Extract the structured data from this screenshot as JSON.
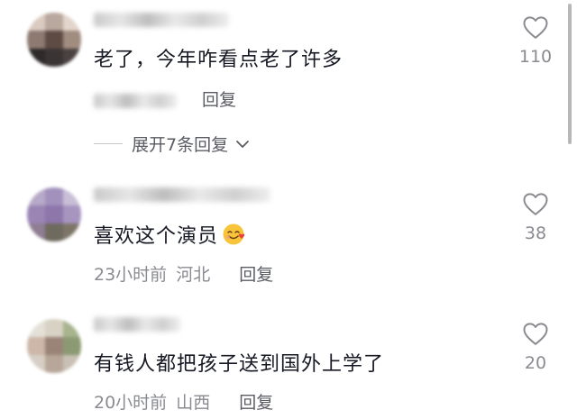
{
  "comments": [
    {
      "text": "老了，今年咋看点老了许多",
      "reply_label": "回复",
      "likes": "110",
      "expand_label": "展开7条回复"
    },
    {
      "text": "喜欢这个演员",
      "time": "23小时前",
      "location": "河北",
      "reply_label": "回复",
      "likes": "38"
    },
    {
      "text": "有钱人都把孩子送到国外上学了",
      "time": "20小时前",
      "location": "山西",
      "reply_label": "回复",
      "likes": "20"
    }
  ],
  "icons": {
    "like": "heart-icon",
    "expand": "chevron-down-icon",
    "emoji": "smiling-face-with-hearts"
  },
  "colors": {
    "text": "#161823",
    "meta": "#8a8b91",
    "reply": "#5b5c63",
    "heart_stroke": "#8a8b91"
  }
}
